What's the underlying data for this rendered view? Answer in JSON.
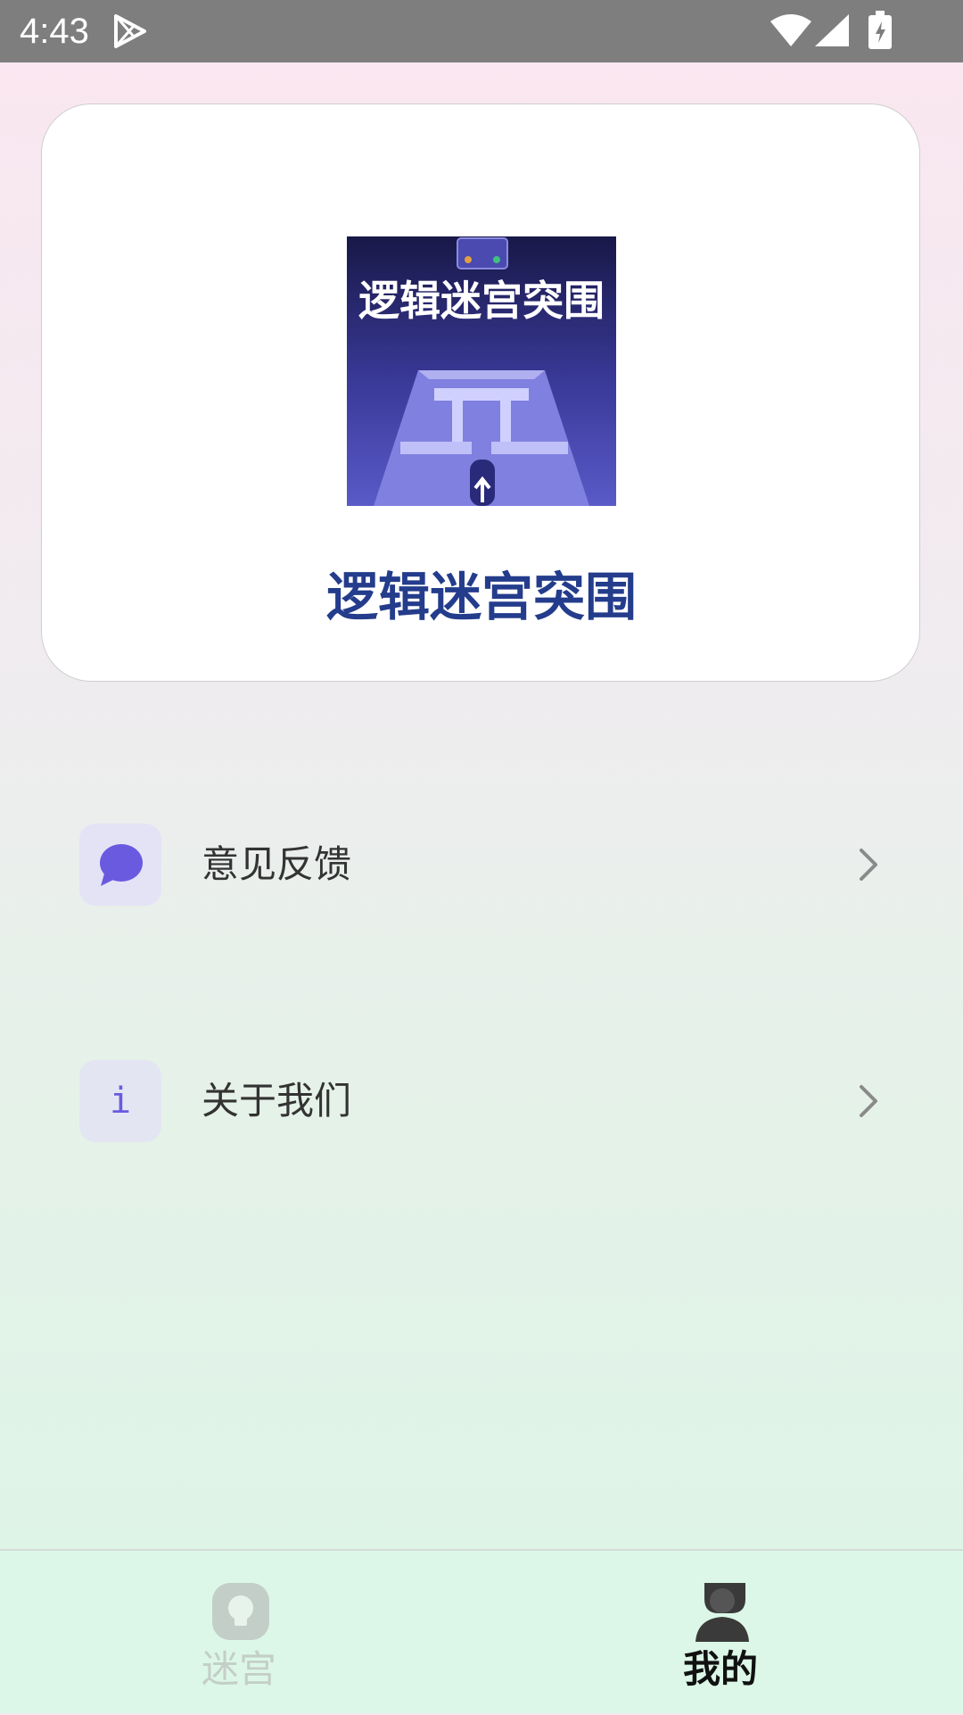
{
  "status_bar": {
    "time": "4:43",
    "icons": [
      "play-store-icon",
      "wifi-icon",
      "signal-icon",
      "battery-icon"
    ]
  },
  "app_card": {
    "app_name": "逻辑迷宫突围",
    "icon_caption": "逻辑迷宫突围"
  },
  "menu": {
    "items": [
      {
        "label": "意见反馈",
        "icon": "chat-bubble-icon"
      },
      {
        "label": "关于我们",
        "icon": "info-icon",
        "icon_glyph": "i"
      }
    ]
  },
  "tab_bar": {
    "tabs": [
      {
        "label": "迷宫",
        "icon": "lightbulb-icon",
        "selected": false
      },
      {
        "label": "我的",
        "icon": "user-icon",
        "selected": true
      }
    ]
  },
  "colors": {
    "accent": "#6a5ae0",
    "title": "#243c8c",
    "tab_active": "#111111",
    "tab_inactive": "#c4cec8"
  }
}
